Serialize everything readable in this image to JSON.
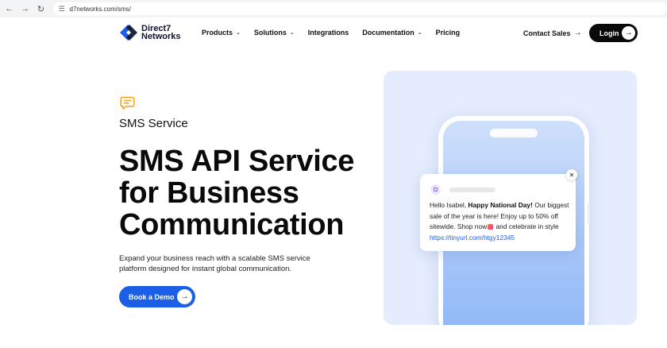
{
  "browser": {
    "url": "d7networks.com/sms/",
    "back_icon": "arrow-left-icon",
    "forward_icon": "arrow-right-icon",
    "reload_icon": "reload-icon"
  },
  "header": {
    "logo": {
      "line1": "Direct7",
      "line2": "Networks"
    },
    "menu": [
      {
        "label": "Products",
        "has_dropdown": true
      },
      {
        "label": "Solutions",
        "has_dropdown": true
      },
      {
        "label": "Integrations",
        "has_dropdown": false
      },
      {
        "label": "Documentation",
        "has_dropdown": true
      },
      {
        "label": "Pricing",
        "has_dropdown": false
      }
    ],
    "contact_label": "Contact Sales",
    "login_label": "Login"
  },
  "hero": {
    "eyebrow": "SMS Service",
    "headline_line1": "SMS API Service",
    "headline_line2": "for Business",
    "headline_line3": "Communication",
    "subtext": "Expand your business reach with a scalable SMS service platform designed for instant global communication.",
    "cta_label": "Book a Demo"
  },
  "notification": {
    "greeting": "Hello Isabel, ",
    "highlight": "Happy National Day!",
    "body1": " Our biggest sale of the year is here! Enjoy up to 50% off sitewide. Shop now",
    "body2": " and celebrate in style",
    "link": "https://tinyurl.com/htgy12345"
  },
  "colors": {
    "brand_blue": "#1a5fe6",
    "dark": "#0a0a0a",
    "panel_bg": "#e4ecfd",
    "accent_orange": "#f5a623"
  }
}
